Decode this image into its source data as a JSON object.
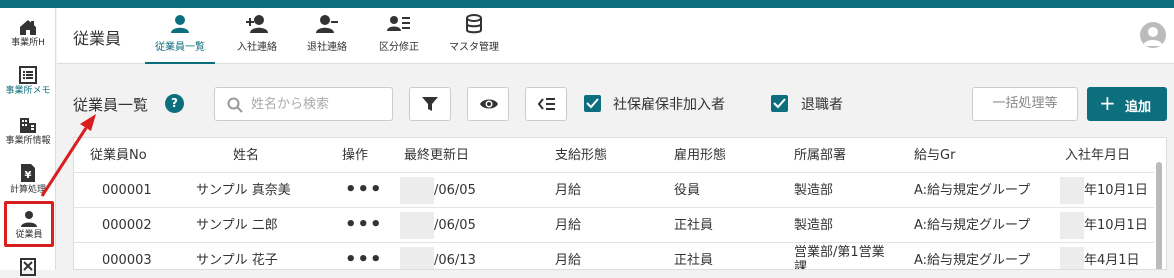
{
  "sidebar": {
    "items": [
      {
        "label": "事業所H",
        "icon": "office-home-icon"
      },
      {
        "label": "事業所メモ",
        "icon": "memo-list-icon"
      },
      {
        "label": "事業所情報",
        "icon": "building-icon"
      },
      {
        "label": "計算処理",
        "icon": "yen-document-icon"
      },
      {
        "label": "従業員",
        "icon": "person-icon"
      },
      {
        "label": "",
        "icon": "tax-document-icon"
      }
    ]
  },
  "header": {
    "title": "従業員",
    "tabs": [
      {
        "label": "従業員一覧",
        "icon": "person-icon"
      },
      {
        "label": "入社連絡",
        "icon": "person-add-icon"
      },
      {
        "label": "退社連絡",
        "icon": "person-remove-icon"
      },
      {
        "label": "区分修正",
        "icon": "person-list-icon"
      },
      {
        "label": "マスタ管理",
        "icon": "database-icon"
      }
    ]
  },
  "toolbar": {
    "title": "従業員一覧",
    "help": "?",
    "search_placeholder": "姓名から検索",
    "checkbox1_label": "社保雇保非加入者",
    "checkbox2_label": "退職者",
    "bulk_label": "一括処理等",
    "add_plus": "+",
    "add_label": "追加"
  },
  "table": {
    "headers": [
      "従業員No",
      "姓名",
      "操作",
      "最終更新日",
      "支給形態",
      "雇用形態",
      "所属部署",
      "給与Gr",
      "入社年月日"
    ],
    "rows": [
      {
        "no": "000001",
        "name": "サンプル 真奈美",
        "ops": "•••",
        "updated": "/06/05",
        "pay": "月給",
        "employment": "役員",
        "dept": "製造部",
        "dept2": "",
        "gr": "A:給与規定グループ",
        "joined": "年10月1日"
      },
      {
        "no": "000002",
        "name": "サンプル 二郎",
        "ops": "•••",
        "updated": "/06/05",
        "pay": "月給",
        "employment": "正社員",
        "dept": "製造部",
        "dept2": "",
        "gr": "A:給与規定グループ",
        "joined": "年10月1日"
      },
      {
        "no": "000003",
        "name": "サンプル 花子",
        "ops": "•••",
        "updated": "/06/13",
        "pay": "月給",
        "employment": "正社員",
        "dept": "営業部/第1営業",
        "dept2": "課",
        "gr": "A:給与規定グループ",
        "joined": "年4月1日"
      }
    ]
  },
  "colors": {
    "accent": "#0d6e7e",
    "highlight": "#d81e1e"
  }
}
